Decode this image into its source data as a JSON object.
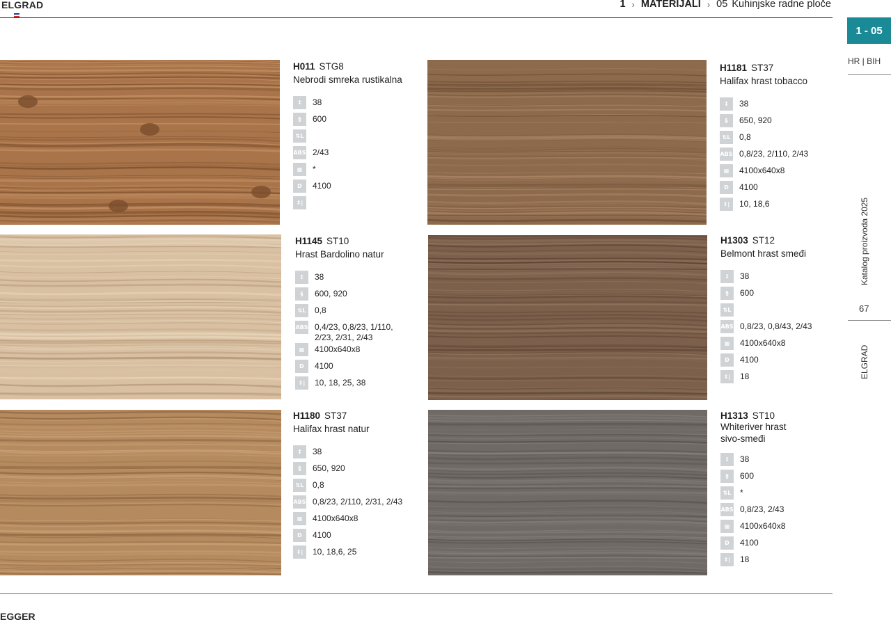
{
  "header": {
    "brand": "ELGRAD",
    "brand_flag_colors": [
      "#1d3f8f",
      "#ffffff",
      "#d22b2b"
    ],
    "breadcrumb": {
      "chapter_num": "1",
      "chapter": "MATERIJALI",
      "section_num": "05",
      "section": "Kuhinjske radne ploče"
    }
  },
  "sidebar": {
    "tab_label": "1 - 05",
    "tab_color": "#1b8a97",
    "lang": "HR | BIH",
    "catalog": "Katalog proizvoda 2025",
    "page": "67",
    "brand": "ELGRAD"
  },
  "footer": {
    "brand": "EGGER"
  },
  "icons": [
    "thickness-icon",
    "depth-icon",
    "edge-thickness-icon",
    "abs-edge-icon",
    "panel-format-icon",
    "length-icon",
    "compatible-thickness-icon"
  ],
  "products": [
    {
      "code": "H011",
      "structure": "STG8",
      "name": "Nebrodi smreka rustikalna",
      "specs": [
        "38",
        "600",
        "",
        "2/43",
        "*",
        "4100",
        ""
      ]
    },
    {
      "code": "H1181",
      "structure": "ST37",
      "name": "Halifax hrast tobacco",
      "specs": [
        "38",
        "650, 920",
        "0,8",
        "0,8/23, 2/110, 2/43",
        "4100x640x8",
        "4100",
        "10, 18,6"
      ]
    },
    {
      "code": "H1145",
      "structure": "ST10",
      "name": "Hrast Bardolino natur",
      "specs": [
        "38",
        "600, 920",
        "0,8",
        "0,4/23, 0,8/23, 1/110,\n2/23, 2/31, 2/43",
        "4100x640x8",
        "4100",
        "10, 18, 25, 38"
      ]
    },
    {
      "code": "H1303",
      "structure": "ST12",
      "name": "Belmont hrast smeđi",
      "specs": [
        "38",
        "600",
        "",
        "0,8/23, 0,8/43,  2/43",
        "4100x640x8",
        "4100",
        "18"
      ]
    },
    {
      "code": "H1180",
      "structure": "ST37",
      "name": "Halifax hrast natur",
      "specs": [
        "38",
        "650, 920",
        "0,8",
        "0,8/23, 2/110, 2/31, 2/43",
        "4100x640x8",
        "4100",
        "10, 18,6, 25"
      ]
    },
    {
      "code": "H1313",
      "structure": "ST10",
      "name": "Whiteriver hrast\nsivo-smeđi",
      "specs": [
        "38",
        "600",
        "*",
        "0,8/23, 2/43",
        "4100x640x8",
        "4100",
        "18"
      ]
    }
  ],
  "swatch_colors": [
    {
      "base": "#a9744a",
      "light": "#c89466",
      "dark": "#7a4e2c"
    },
    {
      "base": "#8e6a4c",
      "light": "#a88364",
      "dark": "#6b4c33"
    },
    {
      "base": "#d9c0a2",
      "light": "#e8d5bc",
      "dark": "#b89b7b"
    },
    {
      "base": "#7d604b",
      "light": "#93765f",
      "dark": "#5b4333"
    },
    {
      "base": "#b58a5e",
      "light": "#caa27a",
      "dark": "#8c6540"
    },
    {
      "base": "#6f6a66",
      "light": "#86807b",
      "dark": "#55504c"
    }
  ]
}
